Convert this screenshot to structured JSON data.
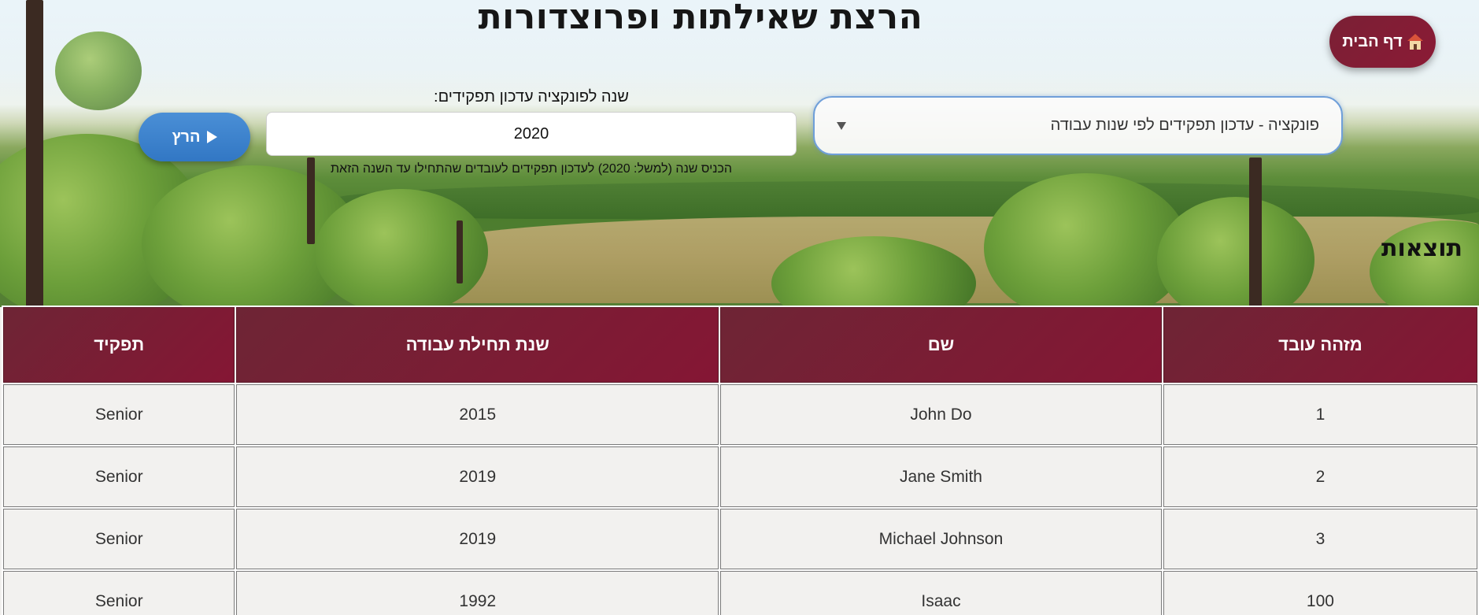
{
  "header": {
    "title": "הרצת שאילתות ופרוצדורות",
    "home_button_label": "דף הבית",
    "home_icon": "house-icon"
  },
  "function_select": {
    "selected": "פונקציה - עדכון תפקידים לפי שנות עבודה"
  },
  "year_field": {
    "label": "שנה לפונקציה עדכון תפקידים:",
    "value": "2020",
    "hint": "הכניס שנה (למשל: 2020) לעדכון תפקידים לעובדים שהתחילו עד השנה הזאת"
  },
  "run_button": {
    "label": "הרץ",
    "icon": "play-icon"
  },
  "results": {
    "title": "תוצאות",
    "columns": [
      "מזהה עובד",
      "שם",
      "שנת תחילת עבודה",
      "תפקיד"
    ],
    "rows": [
      [
        "1",
        "John Do",
        "2015",
        "Senior"
      ],
      [
        "2",
        "Jane Smith",
        "2019",
        "Senior"
      ],
      [
        "3",
        "Michael Johnson",
        "2019",
        "Senior"
      ],
      [
        "100",
        "Isaac",
        "1992",
        "Senior"
      ]
    ]
  },
  "colors": {
    "accent_burgundy": "#851634",
    "run_button_blue": "#3a82cc",
    "select_border_blue": "#6f9fd9"
  }
}
